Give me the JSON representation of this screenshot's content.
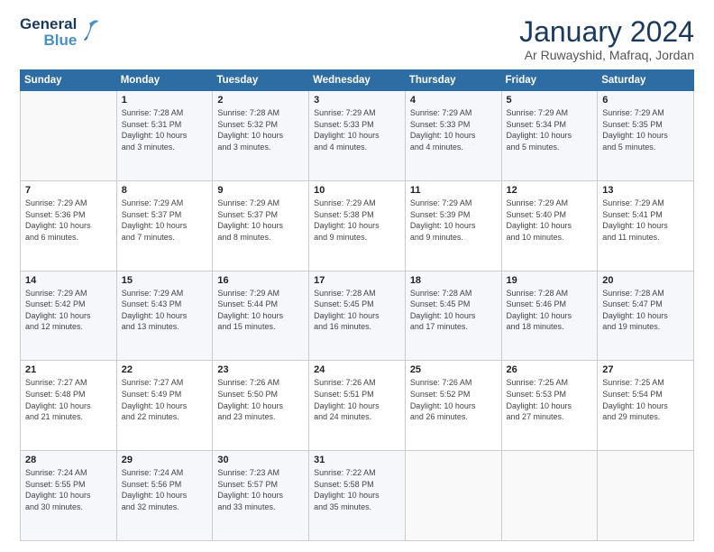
{
  "logo": {
    "line1": "General",
    "line2": "Blue"
  },
  "title": "January 2024",
  "subtitle": "Ar Ruwayshid, Mafraq, Jordan",
  "days_header": [
    "Sunday",
    "Monday",
    "Tuesday",
    "Wednesday",
    "Thursday",
    "Friday",
    "Saturday"
  ],
  "weeks": [
    [
      {
        "num": "",
        "info": ""
      },
      {
        "num": "1",
        "info": "Sunrise: 7:28 AM\nSunset: 5:31 PM\nDaylight: 10 hours\nand 3 minutes."
      },
      {
        "num": "2",
        "info": "Sunrise: 7:28 AM\nSunset: 5:32 PM\nDaylight: 10 hours\nand 3 minutes."
      },
      {
        "num": "3",
        "info": "Sunrise: 7:29 AM\nSunset: 5:33 PM\nDaylight: 10 hours\nand 4 minutes."
      },
      {
        "num": "4",
        "info": "Sunrise: 7:29 AM\nSunset: 5:33 PM\nDaylight: 10 hours\nand 4 minutes."
      },
      {
        "num": "5",
        "info": "Sunrise: 7:29 AM\nSunset: 5:34 PM\nDaylight: 10 hours\nand 5 minutes."
      },
      {
        "num": "6",
        "info": "Sunrise: 7:29 AM\nSunset: 5:35 PM\nDaylight: 10 hours\nand 5 minutes."
      }
    ],
    [
      {
        "num": "7",
        "info": "Sunrise: 7:29 AM\nSunset: 5:36 PM\nDaylight: 10 hours\nand 6 minutes."
      },
      {
        "num": "8",
        "info": "Sunrise: 7:29 AM\nSunset: 5:37 PM\nDaylight: 10 hours\nand 7 minutes."
      },
      {
        "num": "9",
        "info": "Sunrise: 7:29 AM\nSunset: 5:37 PM\nDaylight: 10 hours\nand 8 minutes."
      },
      {
        "num": "10",
        "info": "Sunrise: 7:29 AM\nSunset: 5:38 PM\nDaylight: 10 hours\nand 9 minutes."
      },
      {
        "num": "11",
        "info": "Sunrise: 7:29 AM\nSunset: 5:39 PM\nDaylight: 10 hours\nand 9 minutes."
      },
      {
        "num": "12",
        "info": "Sunrise: 7:29 AM\nSunset: 5:40 PM\nDaylight: 10 hours\nand 10 minutes."
      },
      {
        "num": "13",
        "info": "Sunrise: 7:29 AM\nSunset: 5:41 PM\nDaylight: 10 hours\nand 11 minutes."
      }
    ],
    [
      {
        "num": "14",
        "info": "Sunrise: 7:29 AM\nSunset: 5:42 PM\nDaylight: 10 hours\nand 12 minutes."
      },
      {
        "num": "15",
        "info": "Sunrise: 7:29 AM\nSunset: 5:43 PM\nDaylight: 10 hours\nand 13 minutes."
      },
      {
        "num": "16",
        "info": "Sunrise: 7:29 AM\nSunset: 5:44 PM\nDaylight: 10 hours\nand 15 minutes."
      },
      {
        "num": "17",
        "info": "Sunrise: 7:28 AM\nSunset: 5:45 PM\nDaylight: 10 hours\nand 16 minutes."
      },
      {
        "num": "18",
        "info": "Sunrise: 7:28 AM\nSunset: 5:45 PM\nDaylight: 10 hours\nand 17 minutes."
      },
      {
        "num": "19",
        "info": "Sunrise: 7:28 AM\nSunset: 5:46 PM\nDaylight: 10 hours\nand 18 minutes."
      },
      {
        "num": "20",
        "info": "Sunrise: 7:28 AM\nSunset: 5:47 PM\nDaylight: 10 hours\nand 19 minutes."
      }
    ],
    [
      {
        "num": "21",
        "info": "Sunrise: 7:27 AM\nSunset: 5:48 PM\nDaylight: 10 hours\nand 21 minutes."
      },
      {
        "num": "22",
        "info": "Sunrise: 7:27 AM\nSunset: 5:49 PM\nDaylight: 10 hours\nand 22 minutes."
      },
      {
        "num": "23",
        "info": "Sunrise: 7:26 AM\nSunset: 5:50 PM\nDaylight: 10 hours\nand 23 minutes."
      },
      {
        "num": "24",
        "info": "Sunrise: 7:26 AM\nSunset: 5:51 PM\nDaylight: 10 hours\nand 24 minutes."
      },
      {
        "num": "25",
        "info": "Sunrise: 7:26 AM\nSunset: 5:52 PM\nDaylight: 10 hours\nand 26 minutes."
      },
      {
        "num": "26",
        "info": "Sunrise: 7:25 AM\nSunset: 5:53 PM\nDaylight: 10 hours\nand 27 minutes."
      },
      {
        "num": "27",
        "info": "Sunrise: 7:25 AM\nSunset: 5:54 PM\nDaylight: 10 hours\nand 29 minutes."
      }
    ],
    [
      {
        "num": "28",
        "info": "Sunrise: 7:24 AM\nSunset: 5:55 PM\nDaylight: 10 hours\nand 30 minutes."
      },
      {
        "num": "29",
        "info": "Sunrise: 7:24 AM\nSunset: 5:56 PM\nDaylight: 10 hours\nand 32 minutes."
      },
      {
        "num": "30",
        "info": "Sunrise: 7:23 AM\nSunset: 5:57 PM\nDaylight: 10 hours\nand 33 minutes."
      },
      {
        "num": "31",
        "info": "Sunrise: 7:22 AM\nSunset: 5:58 PM\nDaylight: 10 hours\nand 35 minutes."
      },
      {
        "num": "",
        "info": ""
      },
      {
        "num": "",
        "info": ""
      },
      {
        "num": "",
        "info": ""
      }
    ]
  ]
}
